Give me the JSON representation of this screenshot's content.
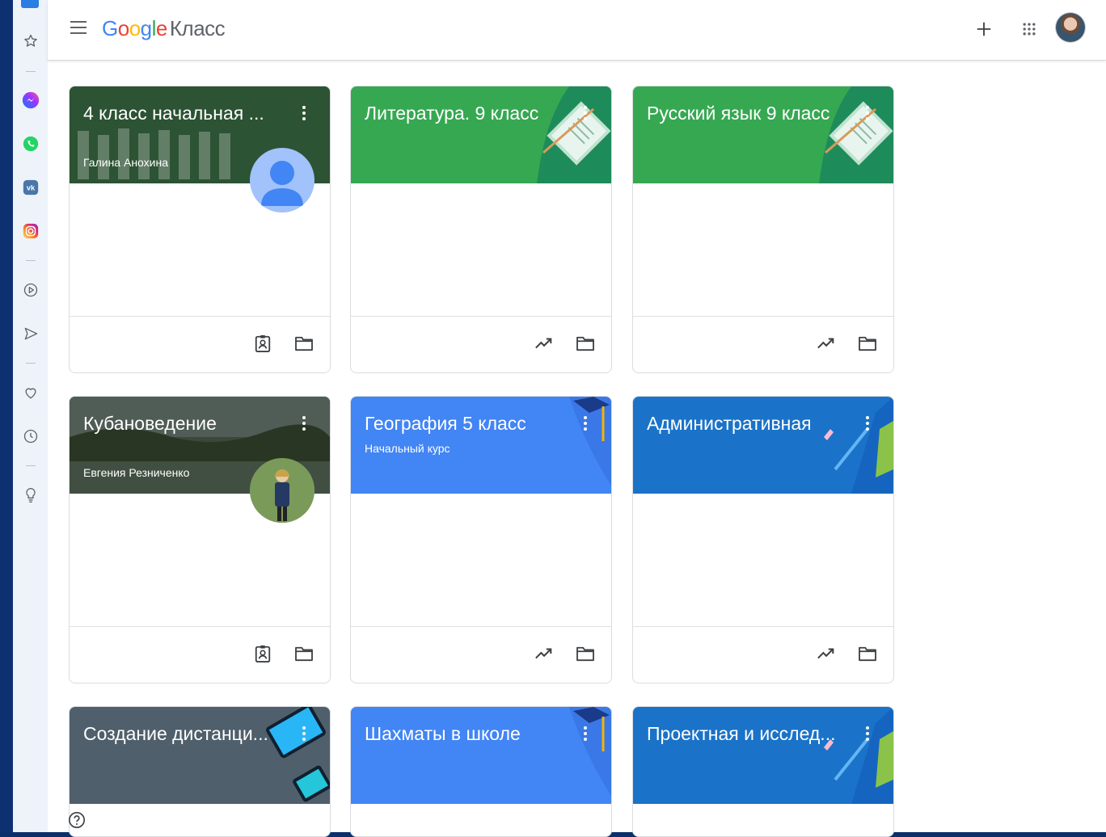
{
  "header": {
    "logo_google": "Google",
    "logo_product": "Класс"
  },
  "sidebar_icons": [
    "star-icon",
    "messenger-icon",
    "whatsapp-icon",
    "vk-icon",
    "instagram-icon",
    "play-circle-icon",
    "send-icon",
    "heart-icon",
    "clock-icon",
    "lightbulb-icon"
  ],
  "cards": [
    {
      "title": "4 класс начальная ...",
      "subtitle": "Галина Анохина",
      "footer_icons": [
        "assignment-icon",
        "folder-icon"
      ]
    },
    {
      "title": "Литература. 9 класс",
      "subtitle": "",
      "footer_icons": [
        "trending-icon",
        "folder-icon"
      ]
    },
    {
      "title": "Русский язык 9 класс",
      "subtitle": "",
      "footer_icons": [
        "trending-icon",
        "folder-icon"
      ]
    },
    {
      "title": "Кубановедение",
      "subtitle": "Евгения Резниченко",
      "footer_icons": [
        "assignment-icon",
        "folder-icon"
      ]
    },
    {
      "title": "География 5 класс",
      "subtitle": "Начальный курс",
      "footer_icons": [
        "trending-icon",
        "folder-icon"
      ]
    },
    {
      "title": "Административная",
      "subtitle": "",
      "footer_icons": [
        "trending-icon",
        "folder-icon"
      ]
    },
    {
      "title": "Создание дистанци...",
      "subtitle": "",
      "footer_icons": []
    },
    {
      "title": "Шахматы в школе",
      "subtitle": "",
      "footer_icons": []
    },
    {
      "title": "Проектная и исслед...",
      "subtitle": "",
      "footer_icons": []
    }
  ],
  "colors": {
    "green": "#36a852",
    "blue": "#4285f4",
    "dark_blue": "#1a73c8",
    "slate": "#4f5f6b",
    "photo_dark": "#3d4a3a"
  }
}
